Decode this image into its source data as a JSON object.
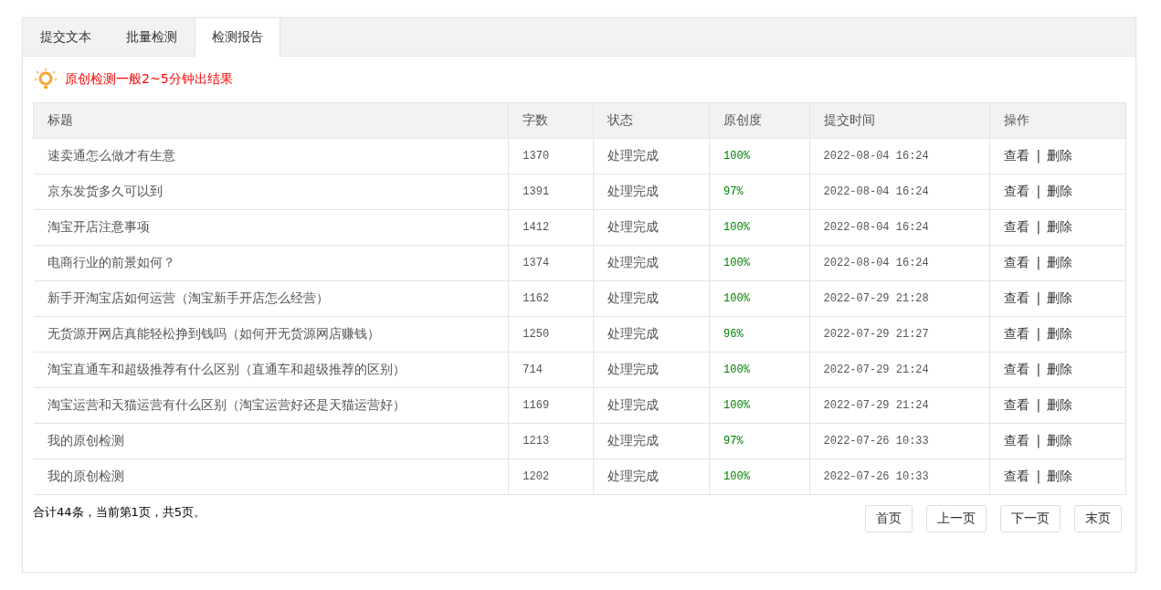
{
  "tabs": [
    {
      "label": "提交文本",
      "selected": false
    },
    {
      "label": "批量检测",
      "selected": false
    },
    {
      "label": "检测报告",
      "selected": true
    }
  ],
  "notice": "原创检测一般2~5分钟出结果",
  "table": {
    "columns": [
      "标题",
      "字数",
      "状态",
      "原创度",
      "提交时间",
      "操作"
    ],
    "rows": [
      {
        "title": "速卖通怎么做才有生意",
        "count": "1370",
        "status": "处理完成",
        "originality": "100%",
        "time": "2022-08-04 16:24",
        "actions": [
          "查看",
          "|",
          "删除"
        ]
      },
      {
        "title": "京东发货多久可以到",
        "count": "1391",
        "status": "处理完成",
        "originality": "97%",
        "time": "2022-08-04 16:24",
        "actions": [
          "查看",
          "|",
          "删除"
        ]
      },
      {
        "title": "淘宝开店注意事项",
        "count": "1412",
        "status": "处理完成",
        "originality": "100%",
        "time": "2022-08-04 16:24",
        "actions": [
          "查看",
          "|",
          "删除"
        ]
      },
      {
        "title": "电商行业的前景如何？",
        "count": "1374",
        "status": "处理完成",
        "originality": "100%",
        "time": "2022-08-04 16:24",
        "actions": [
          "查看",
          "|",
          "删除"
        ]
      },
      {
        "title": "新手开淘宝店如何运营（淘宝新手开店怎么经营）",
        "count": "1162",
        "status": "处理完成",
        "originality": "100%",
        "time": "2022-07-29 21:28",
        "actions": [
          "查看",
          "|",
          "删除"
        ]
      },
      {
        "title": "无货源开网店真能轻松挣到钱吗（如何开无货源网店赚钱）",
        "count": "1250",
        "status": "处理完成",
        "originality": "96%",
        "time": "2022-07-29 21:27",
        "actions": [
          "查看",
          "|",
          "删除"
        ]
      },
      {
        "title": "淘宝直通车和超级推荐有什么区别（直通车和超级推荐的区别）",
        "count": "714",
        "status": "处理完成",
        "originality": "100%",
        "time": "2022-07-29 21:24",
        "actions": [
          "查看",
          "|",
          "删除"
        ]
      },
      {
        "title": "淘宝运营和天猫运营有什么区别（淘宝运营好还是天猫运营好）",
        "count": "1169",
        "status": "处理完成",
        "originality": "100%",
        "time": "2022-07-29 21:24",
        "actions": [
          "查看",
          "|",
          "删除"
        ]
      },
      {
        "title": "我的原创检测",
        "count": "1213",
        "status": "处理完成",
        "originality": "97%",
        "time": "2022-07-26 10:33",
        "actions": [
          "查看",
          "|",
          "删除"
        ]
      },
      {
        "title": "我的原创检测",
        "count": "1202",
        "status": "处理完成",
        "originality": "100%",
        "time": "2022-07-26 10:33",
        "actions": [
          "查看",
          "|",
          "删除"
        ]
      }
    ]
  },
  "pager": {
    "summary": "合计44条，当前第1页，共5页。",
    "buttons": [
      "首页",
      "上一页",
      "下一页",
      "末页"
    ]
  }
}
